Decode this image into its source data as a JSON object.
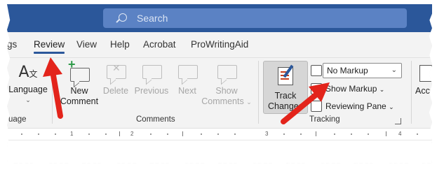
{
  "search": {
    "placeholder": "Search"
  },
  "tabs": [
    "igs",
    "Review",
    "View",
    "Help",
    "Acrobat",
    "ProWritingAid"
  ],
  "groups": {
    "language": {
      "button_label": "Language",
      "group_label": "uage"
    },
    "comments": {
      "group_label": "Comments",
      "new_comment": [
        "New",
        "Comment"
      ],
      "delete": "Delete",
      "previous": "Previous",
      "next": "Next",
      "show_comments": [
        "Show",
        "Comments"
      ]
    },
    "tracking": {
      "group_label": "Tracking",
      "track_changes": [
        "Track",
        "Changes"
      ],
      "markup_select": "No Markup",
      "show_markup": "Show Markup",
      "reviewing_pane": "Reviewing Pane"
    },
    "accessibility": {
      "button_label": "Acce"
    }
  },
  "ruler": {
    "marks": [
      "1",
      "2",
      "3",
      "4"
    ]
  },
  "colors": {
    "titlebar": "#2b579a",
    "search_box": "#5b82c4",
    "accent": "#2b579a",
    "annotation_arrow": "#e3241b"
  }
}
